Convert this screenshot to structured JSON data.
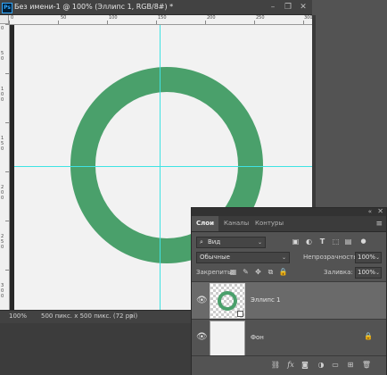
{
  "app": {
    "badge": "Ps"
  },
  "document": {
    "title": "Без имени-1 @ 100% (Эллипс 1, RGB/8#) *",
    "window_controls": {
      "minimize": "–",
      "restore": "❐",
      "close": "✕"
    }
  },
  "rulers": {
    "top_labels": [
      "0",
      "50",
      "100",
      "150",
      "200",
      "250",
      "300"
    ],
    "left_labels": [
      "0",
      "50",
      "100",
      "150",
      "200",
      "250",
      "300"
    ]
  },
  "canvas": {
    "shape_color": "#4aa06b",
    "guide_color": "#3fe3e3",
    "background": "#f2f2f2"
  },
  "statusbar": {
    "zoom": "100%",
    "doc_info": "500 пикс. x 500 пикс. (72 ppi)",
    "arrow": "›"
  },
  "layers_panel": {
    "collapse": "«",
    "close": "✕",
    "tabs": [
      {
        "label": "Слои",
        "active": true
      },
      {
        "label": "Каналы",
        "active": false
      },
      {
        "label": "Контуры",
        "active": false
      }
    ],
    "menu_icon": "≡",
    "filter": {
      "label": "Вид",
      "icon": "search-icon",
      "arrow": "⌄"
    },
    "filter_icons": [
      "image-filter-icon",
      "adjustment-filter-icon",
      "type-filter-icon",
      "shape-filter-icon",
      "smart-object-filter-icon"
    ],
    "blend_mode": {
      "value": "Обычные",
      "arrow": "⌄"
    },
    "opacity": {
      "label": "Непрозрачность:",
      "value": "100%",
      "arrow": "⌄"
    },
    "lock": {
      "label": "Закрепить:"
    },
    "fill": {
      "label": "Заливка:",
      "value": "100%",
      "arrow": "⌄"
    },
    "layers": [
      {
        "name": "Эллипс 1",
        "visible": true,
        "selected": true
      },
      {
        "name": "Фон",
        "visible": true,
        "selected": false,
        "locked": true
      }
    ],
    "bottom_icons": [
      "link-icon",
      "fx-icon",
      "mask-icon",
      "adjustment-icon",
      "group-icon",
      "new-layer-icon",
      "trash-icon"
    ],
    "bottom_fx": "fx",
    "colors": {
      "selected_row": "#6a6a6a",
      "panel_bg": "#535353"
    }
  }
}
